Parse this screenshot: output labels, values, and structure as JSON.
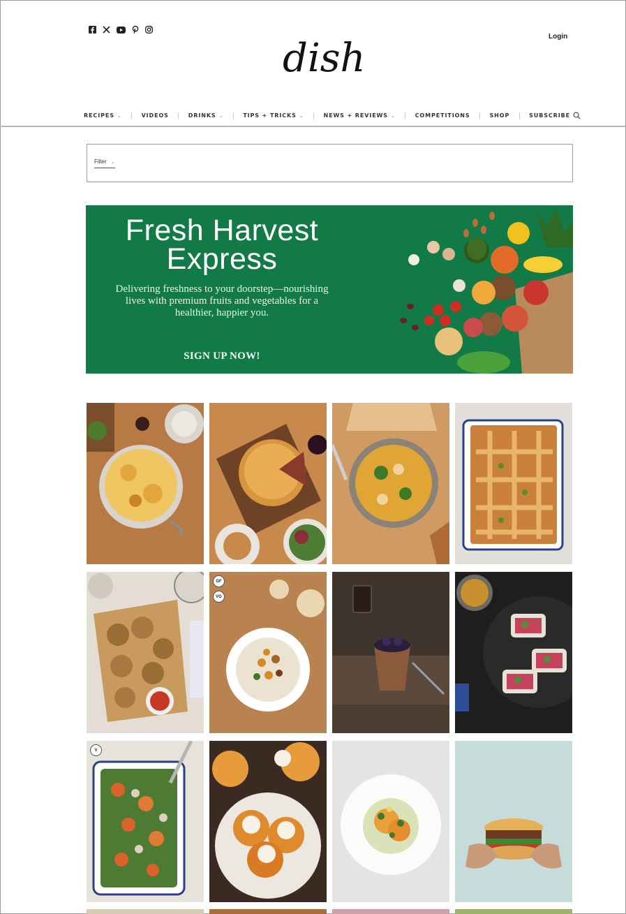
{
  "site": {
    "logo_text": "dish",
    "login_label": "Login"
  },
  "social_icons": [
    "facebook-icon",
    "x-icon",
    "youtube-icon",
    "pinterest-icon",
    "instagram-icon"
  ],
  "nav": {
    "items": [
      {
        "label": "RECIPES",
        "dropdown": true
      },
      {
        "label": "VIDEOS",
        "dropdown": false
      },
      {
        "label": "DRINKS",
        "dropdown": true
      },
      {
        "label": "TIPS + TRICKS",
        "dropdown": true
      },
      {
        "label": "NEWS + REVIEWS",
        "dropdown": true
      },
      {
        "label": "COMPETITIONS",
        "dropdown": false
      },
      {
        "label": "SHOP",
        "dropdown": false
      },
      {
        "label": "SUBSCRIBE",
        "dropdown": false
      }
    ],
    "search_icon": "search-icon"
  },
  "filter": {
    "label": "Filter"
  },
  "banner": {
    "headline_line1": "Fresh Harvest",
    "headline_line2": "Express",
    "tagline": "Delivering freshness to your doorstep—nourishing lives with premium fruits and vegetables for a healthier, happier you.",
    "cta": "SIGN UP NOW!",
    "background": "#127a46"
  },
  "recipes": [
    {
      "badges": []
    },
    {
      "badges": []
    },
    {
      "badges": []
    },
    {
      "badges": []
    },
    {
      "badges": []
    },
    {
      "badges": [
        "GF",
        "VG"
      ]
    },
    {
      "badges": []
    },
    {
      "badges": []
    },
    {
      "badges": [
        "V"
      ]
    },
    {
      "badges": []
    },
    {
      "badges": []
    },
    {
      "badges": []
    }
  ]
}
